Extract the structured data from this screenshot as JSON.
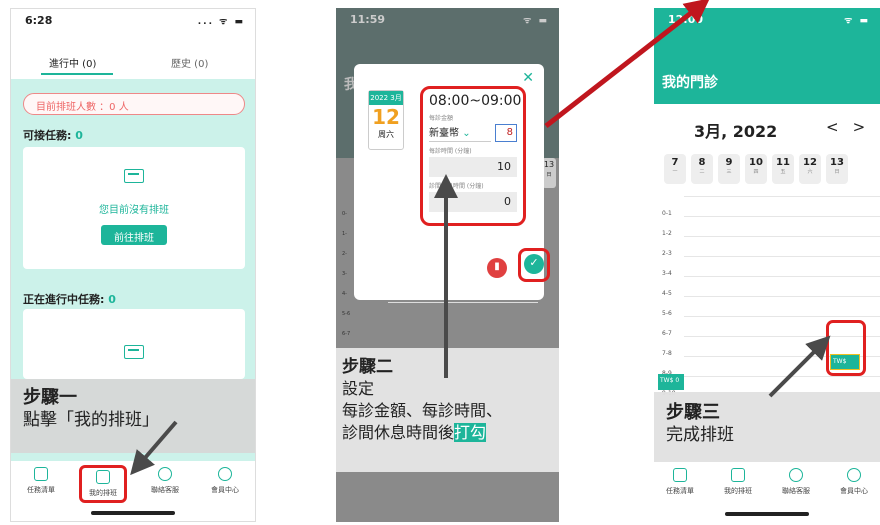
{
  "step1": {
    "time": "6:28",
    "tab_active": "進行中 (0)",
    "tab_history": "歷史 (0)",
    "queue": "目前排班人數 ：0 人",
    "available_label": "可接任務: ",
    "available_count": "0",
    "empty_text": "您目前沒有排班",
    "go_button": "前往排班",
    "ongoing_label": "正在進行中任務: ",
    "ongoing_count": "0",
    "caption_title": "步驟一",
    "caption_body": "點擊「我的排班」",
    "nav": [
      "任務清單",
      "我的排班",
      "聯絡客服",
      "會員中心"
    ]
  },
  "step2": {
    "time": "11:59",
    "bg_title": "我",
    "date_month": "2022 3月",
    "date_day": "12",
    "date_weekday": "周六",
    "time_range": "08:00~09:00",
    "price_label": "每診金額",
    "currency": "新臺幣",
    "price_value": "8",
    "duration_label": "每診時間 (分鐘)",
    "duration_value": "10",
    "rest_label": "診間休息時間 (分鐘)",
    "rest_value": "0",
    "side_day": "13",
    "side_weekday": "日",
    "hours": [
      "0-",
      "1-",
      "2-",
      "3-",
      "4-",
      "5-6",
      "6-7"
    ],
    "caption_title": "步驟二",
    "caption_line1": "設定",
    "caption_line2": "每診金額、每診時間、",
    "caption_line3": "診間休息時間後",
    "caption_highlight": "打勾"
  },
  "step3": {
    "time": "12:00",
    "title": "我的門診",
    "month": "3月, 2022",
    "days": [
      {
        "d": "7",
        "w": "一"
      },
      {
        "d": "8",
        "w": "二"
      },
      {
        "d": "9",
        "w": "三"
      },
      {
        "d": "10",
        "w": "四"
      },
      {
        "d": "11",
        "w": "五"
      },
      {
        "d": "12",
        "w": "六"
      },
      {
        "d": "13",
        "w": "日"
      }
    ],
    "hours": [
      "0-1",
      "1-2",
      "2-3",
      "3-4",
      "4-5",
      "5-6",
      "6-7",
      "7-8",
      "8-9",
      "9-10"
    ],
    "slot_label": "TW$ 0",
    "slot_label2": "TW$",
    "caption_title": "步驟三",
    "caption_body": "完成排班",
    "nav": [
      "任務清單",
      "我的排班",
      "聯絡客服",
      "會員中心"
    ]
  }
}
